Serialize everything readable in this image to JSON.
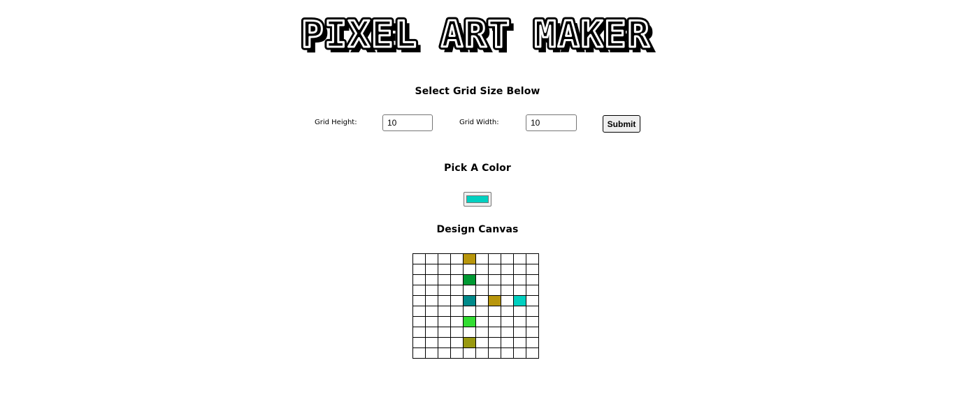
{
  "header": {
    "title": "PIXEL ART MAKER"
  },
  "grid_form": {
    "heading": "Select Grid Size Below",
    "height_label": "Grid Height:",
    "height_value": "10",
    "width_label": "Grid Width:",
    "width_value": "10",
    "submit_label": "Submit"
  },
  "color_section": {
    "heading": "Pick A Color",
    "selected_color": "#00d0c0"
  },
  "canvas_section": {
    "heading": "Design Canvas",
    "rows": 10,
    "cols": 10,
    "colored_cells": [
      {
        "row": 0,
        "col": 4,
        "color": "#b8960c"
      },
      {
        "row": 2,
        "col": 4,
        "color": "#009933"
      },
      {
        "row": 4,
        "col": 4,
        "color": "#008a8a"
      },
      {
        "row": 4,
        "col": 6,
        "color": "#b8960c"
      },
      {
        "row": 4,
        "col": 8,
        "color": "#00d0c0"
      },
      {
        "row": 6,
        "col": 4,
        "color": "#33dd33"
      },
      {
        "row": 8,
        "col": 4,
        "color": "#999911"
      }
    ]
  }
}
